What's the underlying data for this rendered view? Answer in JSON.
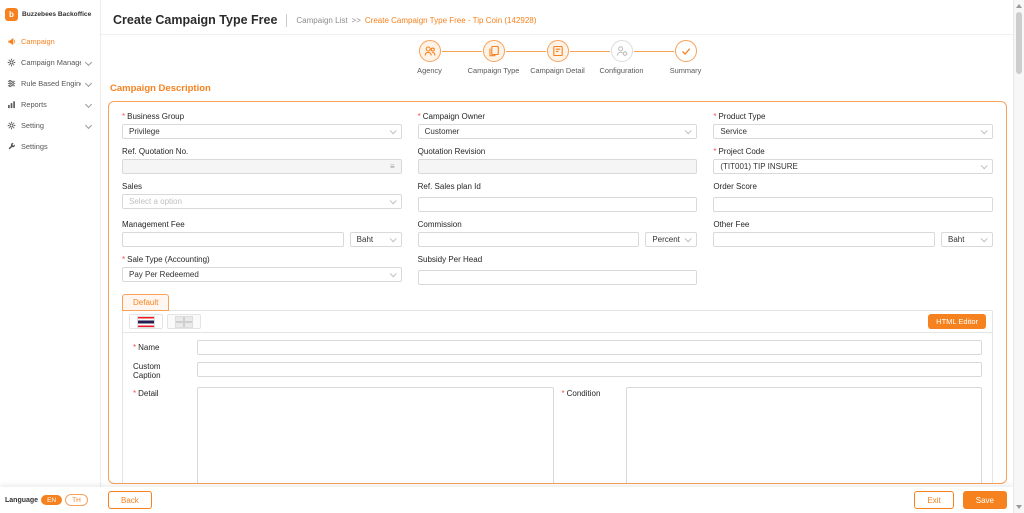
{
  "brand": {
    "name": "Buzzebees Backoffice",
    "logo_letter": "b"
  },
  "sidebar": {
    "items": [
      {
        "label": "Campaign"
      },
      {
        "label": "Campaign Management"
      },
      {
        "label": "Rule Based Engine"
      },
      {
        "label": "Reports"
      },
      {
        "label": "Setting"
      },
      {
        "label": "Settings"
      }
    ]
  },
  "header": {
    "title": "Create Campaign Type Free",
    "breadcrumb": {
      "root": "Campaign List",
      "separator": ">>",
      "current": "Create Campaign Type Free - Tip Coin (142928)"
    }
  },
  "stepper": {
    "steps": [
      {
        "label": "Agency"
      },
      {
        "label": "Campaign Type"
      },
      {
        "label": "Campaign Detail"
      },
      {
        "label": "Configuration"
      },
      {
        "label": "Summary"
      }
    ]
  },
  "section_title": "Campaign Description",
  "form": {
    "required_mark": "*",
    "business_group": {
      "label": "Business Group",
      "value": "Privilege"
    },
    "campaign_owner": {
      "label": "Campaign Owner",
      "value": "Customer"
    },
    "product_type": {
      "label": "Product Type",
      "value": "Service"
    },
    "ref_quotation_no": {
      "label": "Ref. Quotation No.",
      "value": ""
    },
    "quotation_revision": {
      "label": "Quotation Revision",
      "value": ""
    },
    "project_code": {
      "label": "Project Code",
      "value": "(TIT001) TIP INSURE"
    },
    "sales": {
      "label": "Sales",
      "placeholder": "Select a option"
    },
    "ref_sales_plan_id": {
      "label": "Ref. Sales plan Id",
      "value": ""
    },
    "order_score": {
      "label": "Order Score",
      "value": ""
    },
    "management_fee": {
      "label": "Management Fee",
      "unit": "Baht"
    },
    "commission": {
      "label": "Commission",
      "unit": "Percent"
    },
    "other_fee": {
      "label": "Other Fee",
      "unit": "Baht"
    },
    "sale_type_accounting": {
      "label": "Sale Type (Accounting)",
      "value": "Pay Per Redeemed"
    },
    "subsidy_per_head": {
      "label": "Subsidy Per Head",
      "value": ""
    }
  },
  "detail_section": {
    "default_tab": "Default",
    "html_editor_button": "HTML Editor",
    "name_label": "Name",
    "custom_caption_label": "Custom Caption",
    "detail_label": "Detail",
    "condition_label": "Condition"
  },
  "footer": {
    "back": "Back",
    "exit": "Exit",
    "save": "Save",
    "language": {
      "label": "Language",
      "en": "EN",
      "th": "TH"
    }
  }
}
